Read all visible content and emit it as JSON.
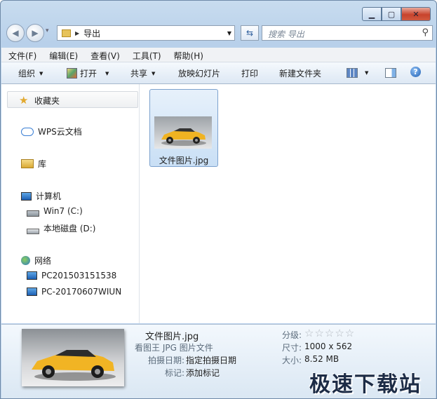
{
  "window": {
    "controls": {
      "minimize": "▁",
      "maximize": "▢",
      "close": "✕"
    }
  },
  "address": {
    "path": "导出",
    "back_icon": "◀",
    "forward_icon": "▶",
    "recent_icon": "▾",
    "refresh_icon": "⇆"
  },
  "search": {
    "placeholder": "搜索 导出",
    "icon": "⚲"
  },
  "menu": {
    "items": [
      "文件(F)",
      "编辑(E)",
      "查看(V)",
      "工具(T)",
      "帮助(H)"
    ]
  },
  "toolbar": {
    "organize": "组织",
    "open": "打开",
    "share": "共享",
    "slideshow": "放映幻灯片",
    "print": "打印",
    "new_folder": "新建文件夹",
    "help": "?"
  },
  "sidebar": {
    "favorites": "收藏夹",
    "wps": "WPS云文档",
    "library": "库",
    "computer": "计算机",
    "drive_c": "Win7 (C:)",
    "drive_d": "本地磁盘 (D:)",
    "network": "网络",
    "pc1": "PC201503151538",
    "pc2": "PC-20170607WIUN"
  },
  "files": [
    {
      "name": "文件图片.jpg",
      "icon": "car-photo"
    }
  ],
  "details": {
    "filename": "文件图片.jpg",
    "type": "看图王 JPG 图片文件",
    "date_label": "拍摄日期:",
    "date_value": "指定拍摄日期",
    "tags_label": "标记:",
    "tags_value": "添加标记",
    "rating_label": "分级:",
    "rating_stars": "☆☆☆☆☆",
    "rating": 0,
    "dims_label": "尺寸:",
    "dims_value": "1000 x 562",
    "size_label": "大小:",
    "size_value": "8.52 MB"
  },
  "watermark": "极速下载站"
}
